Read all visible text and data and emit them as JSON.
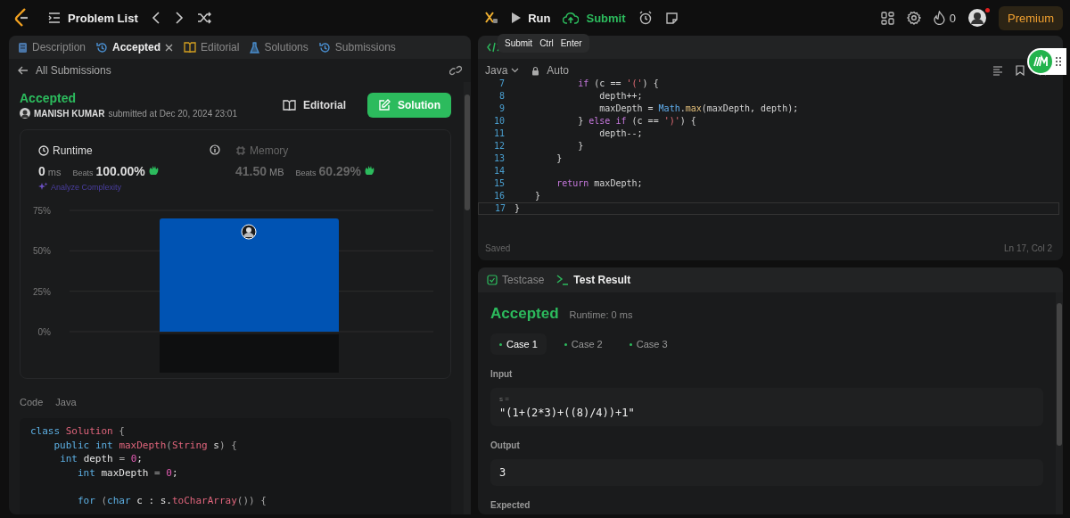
{
  "topbar": {
    "title": "Problem List",
    "actions": [
      {
        "label": "Run",
        "kind": "run"
      },
      {
        "label": "Submit",
        "kind": "submit"
      }
    ],
    "streak": "0",
    "notification": true,
    "premium": "Premium"
  },
  "tooltip": {
    "label": "Submit",
    "keys": [
      "Ctrl",
      "Enter"
    ]
  },
  "left_tabs": [
    {
      "label": "Description",
      "kind": "description",
      "selected": false,
      "closable": false
    },
    {
      "label": "Accepted",
      "kind": "history",
      "selected": true,
      "closable": true
    },
    {
      "label": "Editorial",
      "kind": "book",
      "selected": false,
      "closable": false
    },
    {
      "label": "Solutions",
      "kind": "flask",
      "selected": false,
      "closable": false
    },
    {
      "label": "Submissions",
      "kind": "history",
      "selected": false,
      "closable": false
    }
  ],
  "back_link": "All Submissions",
  "submission": {
    "status": "Accepted",
    "author": "MANISH KUMAR",
    "submitted": "submitted at Dec 20, 2024 23:01",
    "buttons": [
      {
        "label": "Editorial",
        "kind": "editorial"
      },
      {
        "label": "Solution",
        "kind": "solution"
      }
    ]
  },
  "stats": [
    {
      "label": "Runtime",
      "kind": "runtime",
      "selected": true,
      "value": "0",
      "unit": "ms",
      "beats_label": "Beats",
      "beats": "100.00%"
    },
    {
      "label": "Memory",
      "kind": "memory",
      "selected": false,
      "value": "41.50",
      "unit": "MB",
      "beats_label": "Beats",
      "beats": "60.29%"
    }
  ],
  "analyze": "Analyze Complexity",
  "chart_data": {
    "type": "bar",
    "values": [
      70
    ],
    "ylim": [
      0,
      75
    ],
    "yticks": [
      {
        "value": 0,
        "label": "0%"
      },
      {
        "value": 25,
        "label": "25%"
      },
      {
        "value": 50,
        "label": "50%"
      },
      {
        "value": 75,
        "label": "75%"
      }
    ]
  },
  "code_header": {
    "label": "Code",
    "language": "Java"
  },
  "solution_code": [
    {
      "text": "class Solution {",
      "gap_before": false
    },
    {
      "text": "    public int maxDepth(String s) {",
      "gap_before": false
    },
    {
      "text": "     int depth = 0;",
      "gap_before": false
    },
    {
      "text": "        int maxDepth = 0;",
      "gap_before": false
    },
    {
      "text": "        for (char c : s.toCharArray()) {",
      "gap_before": true
    }
  ],
  "editor": {
    "language": "Java",
    "mode": "Auto",
    "status": "Saved",
    "cursor": "Ln 17, Col 2",
    "lines": [
      {
        "number": "7",
        "text": "            if (c == '(') {"
      },
      {
        "number": "8",
        "text": "                depth++;"
      },
      {
        "number": "9",
        "text": "                maxDepth = Math.max(maxDepth, depth);"
      },
      {
        "number": "10",
        "text": "            } else if (c == ')') {"
      },
      {
        "number": "11",
        "text": "                depth--;"
      },
      {
        "number": "12",
        "text": "            }"
      },
      {
        "number": "13",
        "text": "        }"
      },
      {
        "number": "14"
      },
      {
        "number": "15",
        "text": "        return maxDepth;"
      },
      {
        "number": "16",
        "text": "    }"
      },
      {
        "number": "17",
        "text": "}",
        "selected": true
      }
    ]
  },
  "test_tabs": [
    {
      "label": "Testcase",
      "kind": "check",
      "selected": false
    },
    {
      "label": "Test Result",
      "kind": "terminal",
      "selected": true
    }
  ],
  "result": {
    "status": "Accepted",
    "runtime": "Runtime: 0 ms"
  },
  "cases": [
    {
      "label": "Case 1",
      "selected": true
    },
    {
      "label": "Case 2",
      "selected": false
    },
    {
      "label": "Case 3",
      "selected": false
    }
  ],
  "input": {
    "label": "Input",
    "variable": "s =",
    "value": "\"(1+(2*3)+((8)/4))+1\""
  },
  "output": {
    "label": "Output",
    "value": "3"
  },
  "expected": {
    "label": "Expected"
  }
}
